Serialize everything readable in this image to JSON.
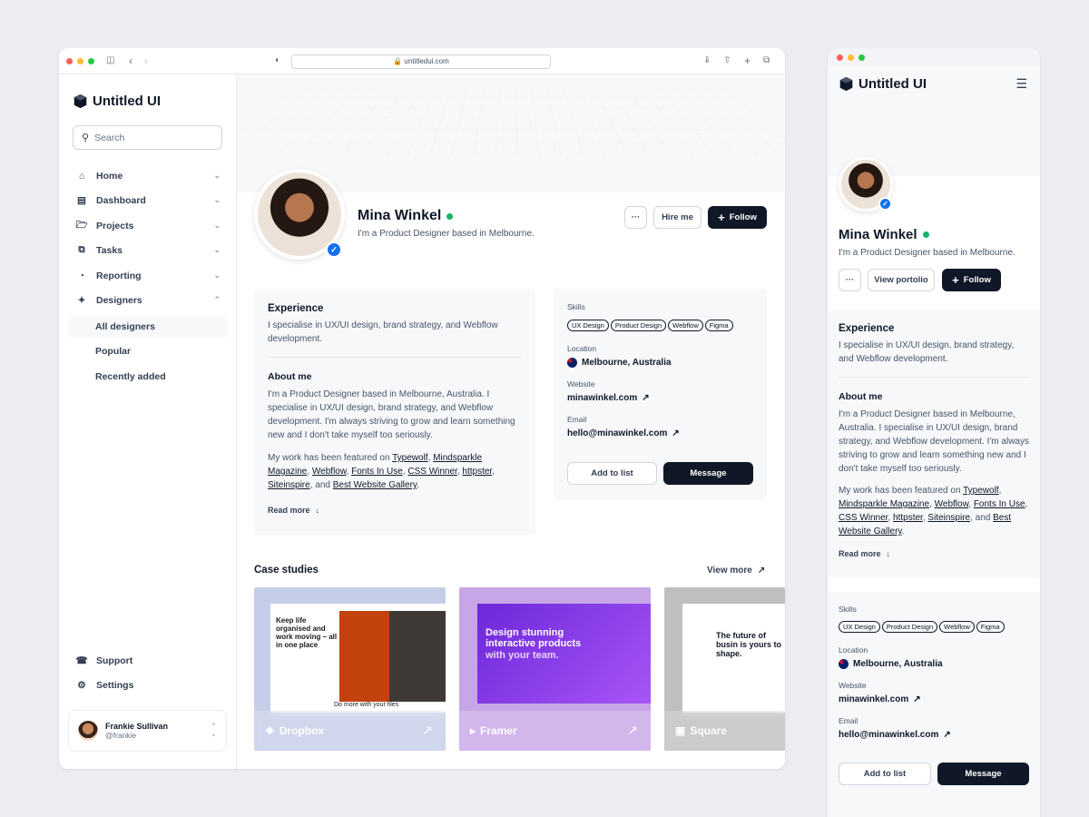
{
  "browser": {
    "url": "untitledui.com"
  },
  "brand": {
    "name": "Untitled UI"
  },
  "search": {
    "placeholder": "Search"
  },
  "nav": {
    "items": [
      {
        "label": "Home"
      },
      {
        "label": "Dashboard"
      },
      {
        "label": "Projects"
      },
      {
        "label": "Tasks"
      },
      {
        "label": "Reporting"
      },
      {
        "label": "Designers"
      }
    ],
    "sub": [
      {
        "label": "All designers"
      },
      {
        "label": "Popular"
      },
      {
        "label": "Recently added"
      }
    ],
    "footer": [
      {
        "label": "Support"
      },
      {
        "label": "Settings"
      }
    ]
  },
  "user": {
    "name": "Frankie Sullivan",
    "handle": "@frankie"
  },
  "profile": {
    "name": "Mina Winkel",
    "bio": "I'm a Product Designer based in Melbourne.",
    "more": "···",
    "hire": "Hire me",
    "follow": "Follow",
    "view_portfolio": "View portolio"
  },
  "experience": {
    "title": "Experience",
    "text": "I specialise in UX/UI design, brand strategy, and Webflow development."
  },
  "about": {
    "title": "About me",
    "text": "I'm a Product Designer based in Melbourne, Australia. I specialise in UX/UI design, brand strategy, and Webflow development. I'm always striving to grow and learn something new and I don't take myself too seriously.",
    "featured_pre": "My work has been featured on ",
    "links": [
      "Typewolf",
      "Mindsparkle Magazine",
      "Webflow",
      "Fonts In Use",
      "CSS Winner",
      "httpster",
      "Siteinspire",
      "Best Website Gallery"
    ],
    "sep": ", ",
    "and": ", and ",
    "end": ".",
    "read_more": "Read more"
  },
  "details": {
    "skills_label": "Skills",
    "skills": [
      "UX Design",
      "Product Design",
      "Webflow",
      "Figma"
    ],
    "location_label": "Location",
    "location": "Melbourne, Australia",
    "website_label": "Website",
    "website": "minawinkel.com",
    "email_label": "Email",
    "email": "hello@minawinkel.com",
    "add_to_list": "Add to list",
    "message": "Message"
  },
  "case_studies": {
    "title": "Case studies",
    "view_more": "View more",
    "items": [
      {
        "brand": "Dropbox",
        "bg": "#c5cee8",
        "headline": "Keep life organised and work moving – all in one place",
        "caption": "Do more with your files"
      },
      {
        "brand": "Framer",
        "bg": "#c7a6e8",
        "headline": "Design stunning interactive products",
        "sub": "with your team."
      },
      {
        "brand": "Square",
        "bg": "#bfbfbf",
        "headline": "The future of busin is yours to shape."
      }
    ]
  },
  "colors": {
    "primary": "#101828",
    "online": "#17b26a",
    "verified": "#1570ef"
  }
}
